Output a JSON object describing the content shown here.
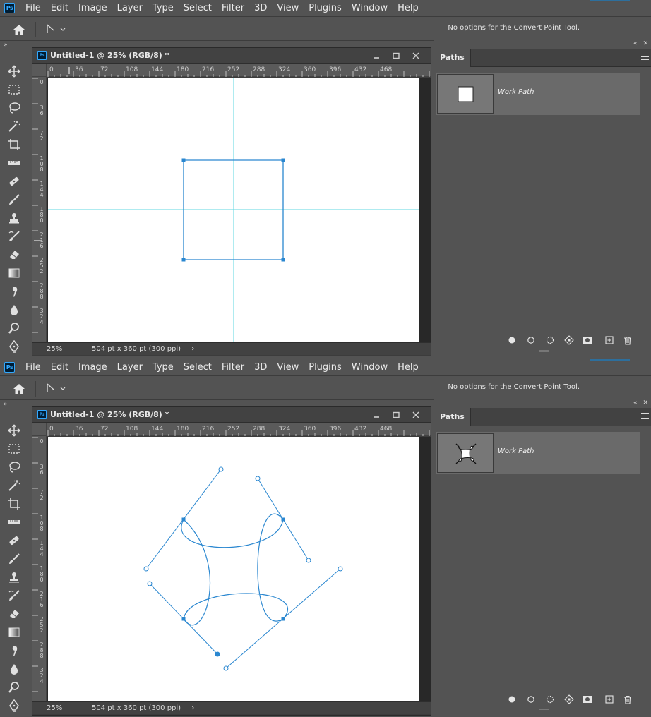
{
  "app": {
    "logo_text": "Ps",
    "menu": [
      "File",
      "Edit",
      "Image",
      "Layer",
      "Type",
      "Select",
      "Filter",
      "3D",
      "View",
      "Plugins",
      "Window",
      "Help"
    ]
  },
  "options_bar": {
    "message": "No options for the Convert Point Tool."
  },
  "document": {
    "title": "Untitled-1 @ 25% (RGB/8) *",
    "zoom": "25%",
    "info": "504 pt x 360 pt (300 ppi)",
    "h_ruler_labels": [
      "0",
      "36",
      "72",
      "108",
      "144",
      "180",
      "216",
      "252",
      "288",
      "324",
      "360",
      "396",
      "432",
      "468"
    ],
    "v_ruler_labels": [
      "0",
      "36",
      "72",
      "108",
      "144",
      "180",
      "216",
      "252",
      "288",
      "324"
    ]
  },
  "paths_panel": {
    "tab_label": "Paths",
    "path_name": "Work Path"
  },
  "screens": [
    {
      "state": "before",
      "path_shape": "square"
    },
    {
      "state": "after",
      "path_shape": "twisted"
    }
  ],
  "colors": {
    "path_blue": "#2a87d0",
    "guide_cyan": "#5fd7e0",
    "ui_bg": "#535353"
  },
  "icons": {
    "tools": [
      "move-icon",
      "marquee-icon",
      "lasso-icon",
      "magic-wand-icon",
      "crop-icon",
      "ruler-icon",
      "healing-brush-icon",
      "brush-icon",
      "stamp-icon",
      "history-brush-icon",
      "eraser-icon",
      "gradient-icon",
      "smudge-icon",
      "blur-icon",
      "zoom-icon",
      "pen-icon"
    ],
    "panel_footer": [
      "fill-path-icon",
      "stroke-path-icon",
      "load-selection-icon",
      "make-work-path-icon",
      "add-mask-icon",
      "new-path-icon",
      "delete-path-icon"
    ]
  }
}
